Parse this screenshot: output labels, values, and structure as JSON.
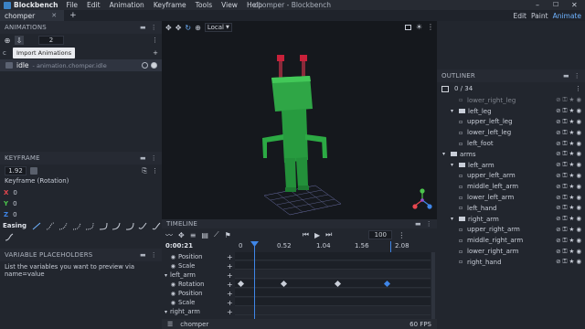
{
  "app": {
    "name": "Blockbench",
    "window_title": "chomper - Blockbench"
  },
  "menu": [
    "File",
    "Edit",
    "Animation",
    "Keyframe",
    "Tools",
    "View",
    "Help"
  ],
  "tabs": [
    {
      "label": "chomper"
    }
  ],
  "modes": [
    "Edit",
    "Paint",
    "Animate"
  ],
  "animations": {
    "title": "ANIMATIONS",
    "speed_value": "2",
    "tooltip": "Import Animations",
    "group_prefix": "c",
    "item": {
      "name": "idle",
      "path": "- animation.chomper.idle"
    }
  },
  "keyframe": {
    "title": "KEYFRAME",
    "time_value": "1.92",
    "label": "Keyframe (Rotation)",
    "axes": [
      {
        "name": "X",
        "value": "0",
        "color": "#e8474f"
      },
      {
        "name": "Y",
        "value": "0",
        "color": "#4cc44c"
      },
      {
        "name": "Z",
        "value": "0",
        "color": "#3f86e8"
      }
    ],
    "easing_label": "Easing"
  },
  "variables": {
    "title": "VARIABLE PLACEHOLDERS",
    "text": "List the variables you want to preview via name=value"
  },
  "viewport": {
    "view_mode": "Local"
  },
  "outliner": {
    "title": "OUTLINER",
    "count": "0 / 34",
    "items": [
      {
        "label": "lower_right_leg",
        "depth": 2,
        "group": false
      },
      {
        "label": "left_leg",
        "depth": 1,
        "group": true
      },
      {
        "label": "upper_left_leg",
        "depth": 2,
        "group": false
      },
      {
        "label": "lower_left_leg",
        "depth": 2,
        "group": false
      },
      {
        "label": "left_foot",
        "depth": 2,
        "group": false
      },
      {
        "label": "arms",
        "depth": 0,
        "group": true
      },
      {
        "label": "left_arm",
        "depth": 1,
        "group": true
      },
      {
        "label": "upper_left_arm",
        "depth": 2,
        "group": false
      },
      {
        "label": "middle_left_arm",
        "depth": 2,
        "group": false
      },
      {
        "label": "lower_left_arm",
        "depth": 2,
        "group": false
      },
      {
        "label": "left_hand",
        "depth": 2,
        "group": false
      },
      {
        "label": "right_arm",
        "depth": 1,
        "group": true
      },
      {
        "label": "upper_right_arm",
        "depth": 2,
        "group": false
      },
      {
        "label": "middle_right_arm",
        "depth": 2,
        "group": false
      },
      {
        "label": "lower_right_arm",
        "depth": 2,
        "group": false
      },
      {
        "label": "right_hand",
        "depth": 2,
        "group": false
      }
    ]
  },
  "timeline": {
    "title": "TIMELINE",
    "time": "0:00:21",
    "fps_field": "100",
    "ruler": [
      "0",
      "0.52",
      "1.04",
      "1.56",
      "2.08"
    ],
    "rows": [
      {
        "label": "Position",
        "indent": true
      },
      {
        "label": "Scale",
        "indent": true
      },
      {
        "label": "left_arm",
        "indent": false
      },
      {
        "label": "Rotation",
        "indent": true
      },
      {
        "label": "Position",
        "indent": true
      },
      {
        "label": "Scale",
        "indent": true
      },
      {
        "label": "right_arm",
        "indent": false
      }
    ]
  },
  "status": {
    "model": "chomper",
    "fps": "60 FPS"
  },
  "colors": {
    "accent": "#3f86e8",
    "selected_mode": "#6fb3ff",
    "model_green": "#33b34a",
    "antenna_red": "#c8213a"
  }
}
